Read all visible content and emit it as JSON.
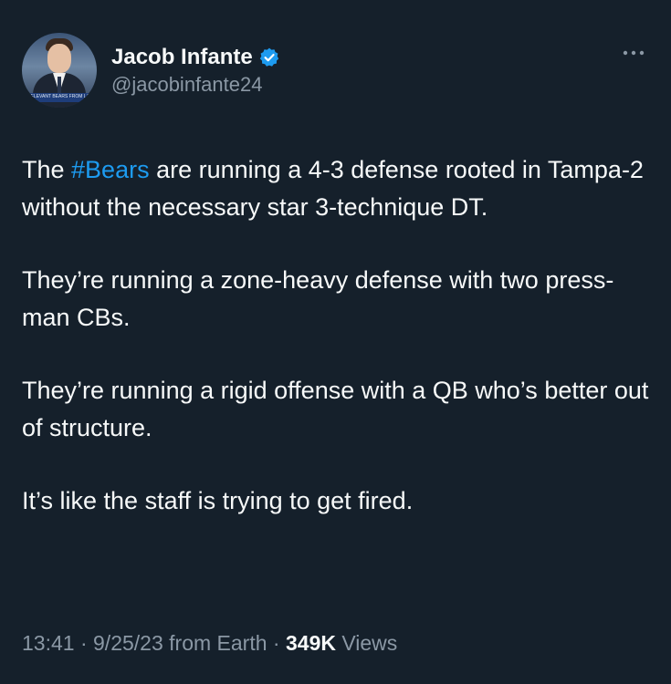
{
  "author": {
    "display_name": "Jacob Infante",
    "handle": "@jacobinfante24",
    "verified": true,
    "avatar_banner_text": "RELEVANT BEARS FROM LAST"
  },
  "tweet": {
    "paragraphs": [
      {
        "segments": [
          {
            "text": "The ",
            "type": "text"
          },
          {
            "text": "#Bears",
            "type": "hashtag"
          },
          {
            "text": " are running a 4-3 defense rooted in Tampa-2 without the necessary star 3-technique DT.",
            "type": "text"
          }
        ]
      },
      {
        "segments": [
          {
            "text": "They’re running a zone-heavy defense with two press-man CBs.",
            "type": "text"
          }
        ]
      },
      {
        "segments": [
          {
            "text": "They’re running a rigid offense with a QB who’s better out of structure.",
            "type": "text"
          }
        ]
      },
      {
        "segments": [
          {
            "text": "It’s like the staff is trying to get fired.",
            "type": "text"
          }
        ]
      }
    ]
  },
  "meta": {
    "time": "13:41",
    "separator": " · ",
    "date": "9/25/23",
    "source": " from Earth",
    "views_count": "349K",
    "views_label": " Views"
  },
  "icons": {
    "verified": "verified-badge-icon",
    "more": "more-options-icon"
  },
  "colors": {
    "background": "#15202b",
    "text": "#f7f9f9",
    "secondary": "#8b98a5",
    "accent": "#1d9bf0"
  }
}
